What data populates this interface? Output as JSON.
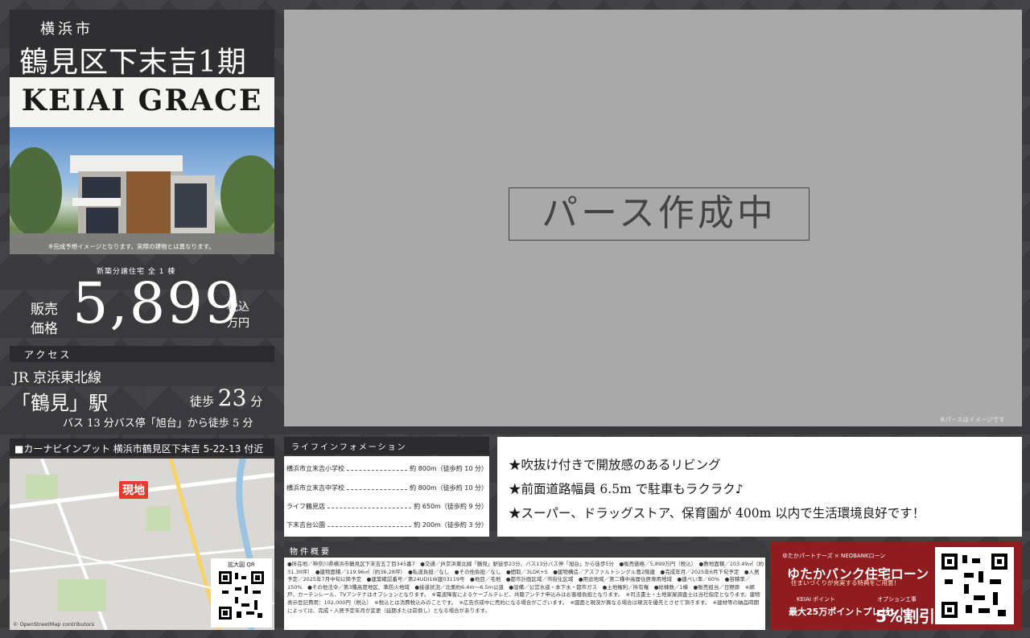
{
  "header": {
    "city": "横浜市",
    "area": "鶴見区下末吉1期",
    "brand": "KEIAI GRACE"
  },
  "photo": {
    "caption": "※完成予想イメージとなります。実際の建物とは異なります。"
  },
  "price": {
    "units_label": "新築分譲住宅 全 1 棟",
    "label": "販売価格",
    "value": "5,899",
    "unit": "税込万円"
  },
  "access": {
    "label": "アクセス",
    "line": "JR 京浜東北線",
    "station": "「鶴見」駅",
    "walk_prefix": "徒歩",
    "walk_minutes": "23",
    "walk_suffix": "分",
    "bus": "バス 13 分バス停「旭台」から徒歩 5 分"
  },
  "nav": {
    "text": "■カーナビインプット 横浜市鶴見区下末吉 5-22-13 付近",
    "marker": "現地",
    "qr_label": "拡大図 QR",
    "credit": "© OpenStreetMap contributors"
  },
  "render": {
    "message": "パース作成中",
    "note": "※パースはイメージです"
  },
  "life": {
    "label": "ライフインフォメーション",
    "items": [
      {
        "name": "横浜市立末吉小学校",
        "dist": "約 800m（徒歩約 10 分）"
      },
      {
        "name": "横浜市立末吉中学校",
        "dist": "約 800m（徒歩約 10 分）"
      },
      {
        "name": "ライフ鶴見店",
        "dist": "約 650m（徒歩約 9 分）"
      },
      {
        "name": "下末吉台公園",
        "dist": "約 200m（徒歩約 3 分）"
      }
    ]
  },
  "features": [
    "★吹抜け付きで開放感のあるリビング",
    "★前面道路幅員 6.5m で駐車もラクラク♪",
    "★スーパー、ドラッグストア、保育園が 400m 以内で生活環境良好です！"
  ],
  "property": {
    "label": "物件概要",
    "text": "●所在地／神奈川県横浜市鶴見区下末吉五丁目345番7　●交通／JR京浜東北線「鶴見」駅徒歩23分、バス13分バス停「旭台」から徒歩5分　●販売価格／5,899万円（税込）　●敷地面積／103.49㎡（約31.30坪）　●建物面積／119.96㎡（約36.28坪）　●私道負担／なし　●その他負担／なし　●間取／3LDK+S　●建物構造／アスファルトシングル葺2階建　●完成年月／2025年6月下旬予定　●入居予定／2025年7月中旬以降予定　●建築確認番号／第24UDI1W建03119号　●地目／宅地　●都市計画区域／市街化区域　●用途地域／第二種中高層住居専用地域　●建ぺい率／60%　●容積率／150%　●その他法令／第3種高度地区、準防火地域　●接道状況／北側約6.4m〜6.5m公道　●設備／公営水道・本下水・都市ガス　●土地権利／所有権　●総棟数／1棟　●販売担当／日野原　※網戸、カーテンレール、TVアンテナはオプションとなります。　※電波障害によるケーブルテレビ、共聴アンテナ申込みはお客様負担となります。　※司法書士・土地家屋調査士は当社指定となります。建物表示登記費用：102,000円（税込）　※税込とは消費税込みのことです。　※広告作成中に売約になる場合がございます。　※図面と現況が異なる場合は現況を優先とさせて頂きます。　※建材等の納品時期によっては、完成・入居予定年月が変更（延期または前倒し）となる場合があります。"
  },
  "loan": {
    "top": "ゆたかパートナーズ × NEOBANKローン",
    "title": "ゆたかバンク住宅ローン",
    "sub": "住まいづくりが充実する特典をご用意！",
    "pts_label": "KEIAI ポイント",
    "pts": "最大25万ポイントプレゼント",
    "opt_label": "オプション工事",
    "opt": "5%割引"
  }
}
